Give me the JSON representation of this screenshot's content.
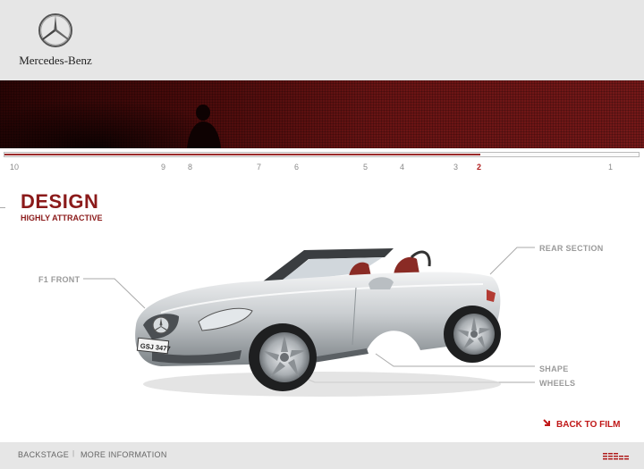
{
  "header": {
    "brand": "Mercedes-Benz"
  },
  "timeline": {
    "progress_fraction": 0.75,
    "ticks": [
      "10",
      "9",
      "8",
      "7",
      "6",
      "5",
      "4",
      "3",
      "2",
      "1"
    ],
    "active": "2"
  },
  "section": {
    "title": "DESIGN",
    "subtitle": "HIGHLY ATTRACTIVE"
  },
  "callouts": {
    "f1_front": "F1 FRONT",
    "rear_section": "REAR SECTION",
    "shape": "SHAPE",
    "wheels": "WHEELS"
  },
  "car": {
    "plate": "GSJ 3477"
  },
  "actions": {
    "back_to_film": "BACK TO FILM"
  },
  "footer": {
    "backstage": "BACKSTAGE",
    "separator": "|",
    "more_info": "MORE INFORMATION"
  },
  "colors": {
    "accent": "#8b1a1a",
    "banner": "#6a1414",
    "link": "#c01818",
    "header_bg": "#e6e6e6"
  }
}
